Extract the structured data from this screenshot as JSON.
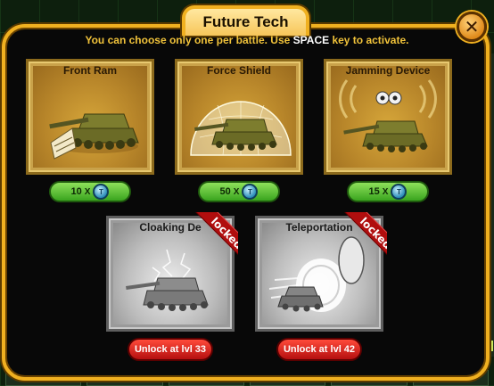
{
  "dialog": {
    "title": "Future Tech",
    "instructions": {
      "prefix": "You can choose only one per battle. Use ",
      "key": "SPACE",
      "suffix": " key to activate."
    },
    "close_icon": "close-icon"
  },
  "cards": [
    {
      "title": "Front Ram",
      "cost": "10",
      "multiplier": "X",
      "state": "available",
      "icon": "front-ram-tank-icon"
    },
    {
      "title": "Force Shield",
      "cost": "50",
      "multiplier": "X",
      "state": "available",
      "icon": "force-shield-tank-icon"
    },
    {
      "title": "Jamming Device",
      "cost": "15",
      "multiplier": "X",
      "state": "available",
      "icon": "jamming-device-tank-icon"
    },
    {
      "title": "Cloaking De",
      "state": "locked",
      "ribbon": "locked",
      "unlock_label": "Unlock at lvl 33",
      "icon": "cloaking-device-tank-icon"
    },
    {
      "title": "Teleportation",
      "state": "locked",
      "ribbon": "locked",
      "unlock_label": "Unlock at lvl 42",
      "icon": "teleportation-tank-icon"
    }
  ],
  "colors": {
    "frame_gold": "#f0b020",
    "title_text": "#f0c23a",
    "cost_green": "#3aa41e",
    "unlock_red": "#b40f0f"
  }
}
